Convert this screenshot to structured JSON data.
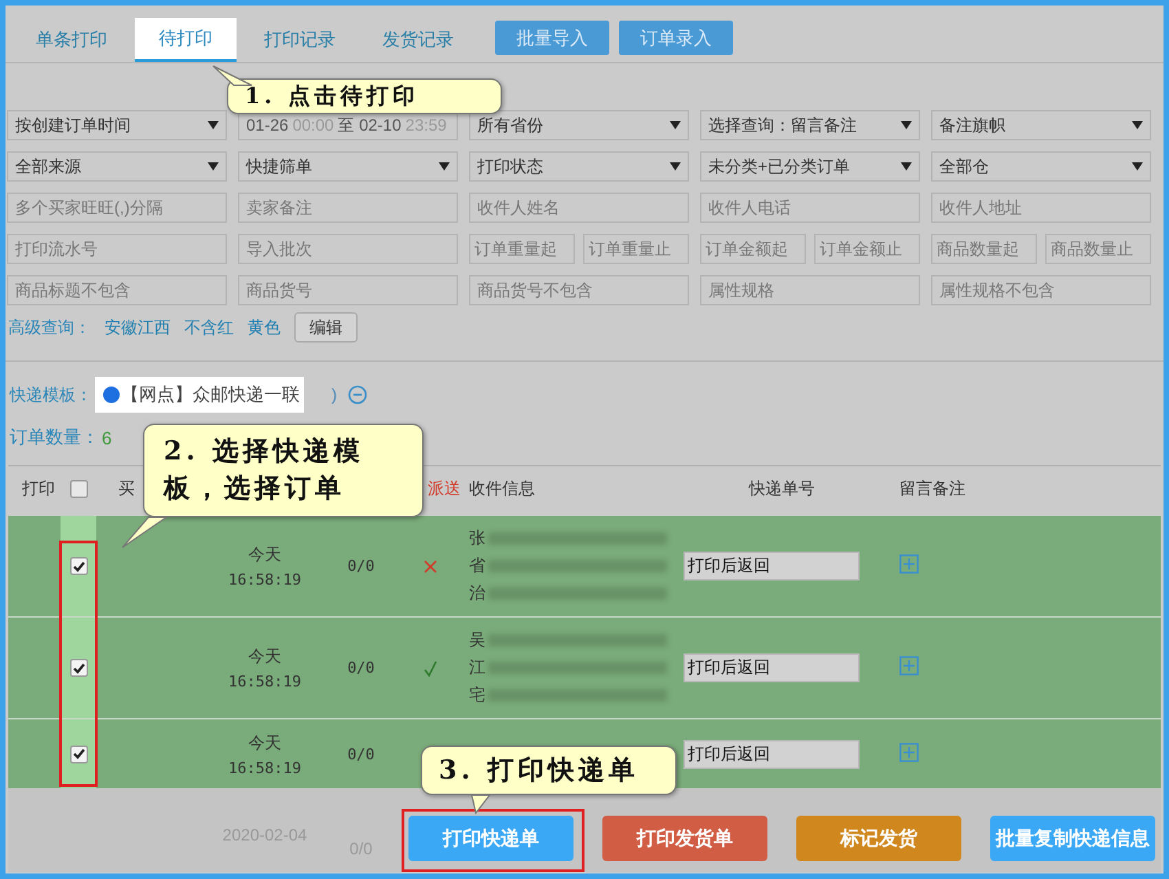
{
  "tabs": [
    {
      "label": "单条打印",
      "selected": false
    },
    {
      "label": "待打印",
      "selected": true
    },
    {
      "label": "打印记录",
      "selected": false
    },
    {
      "label": "发货记录",
      "selected": false
    }
  ],
  "top_buttons": [
    "批量导入",
    "订单录入"
  ],
  "filter_rows": [
    [
      {
        "kind": "select",
        "text": "按创建订单时间"
      },
      {
        "kind": "date",
        "start": "01-26",
        "start_time": "00:00",
        "sep": "至",
        "end": "02-10",
        "end_time": "23:59"
      },
      {
        "kind": "select",
        "text": "所有省份"
      },
      {
        "kind": "select",
        "text": "选择查询：留言备注"
      },
      {
        "kind": "select",
        "text": "备注旗帜"
      }
    ],
    [
      {
        "kind": "select",
        "text": "全部来源"
      },
      {
        "kind": "select",
        "text": "快捷筛单"
      },
      {
        "kind": "select",
        "text": "打印状态"
      },
      {
        "kind": "select",
        "text": "未分类+已分类订单"
      },
      {
        "kind": "select",
        "text": "全部仓"
      }
    ],
    [
      {
        "kind": "field",
        "placeholder": "多个买家旺旺(,)分隔"
      },
      {
        "kind": "field",
        "placeholder": "卖家备注"
      },
      {
        "kind": "field",
        "placeholder": "收件人姓名"
      },
      {
        "kind": "field",
        "placeholder": "收件人电话"
      },
      {
        "kind": "field",
        "placeholder": "收件人地址"
      }
    ],
    [
      {
        "kind": "field",
        "placeholder": "打印流水号"
      },
      {
        "kind": "field",
        "placeholder": "导入批次"
      },
      {
        "kind": "pair",
        "placeholders": [
          "订单重量起",
          "订单重量止"
        ]
      },
      {
        "kind": "pair",
        "placeholders": [
          "订单金额起",
          "订单金额止"
        ]
      },
      {
        "kind": "pair",
        "placeholders": [
          "商品数量起",
          "商品数量止"
        ]
      }
    ],
    [
      {
        "kind": "field",
        "placeholder": "商品标题不包含"
      },
      {
        "kind": "field",
        "placeholder": "商品货号"
      },
      {
        "kind": "field",
        "placeholder": "商品货号不包含"
      },
      {
        "kind": "field",
        "placeholder": "属性规格"
      },
      {
        "kind": "field",
        "placeholder": "属性规格不包含"
      }
    ]
  ],
  "advanced": {
    "label": "高级查询：",
    "tags": [
      "安徽江西",
      "不含红",
      "黄色"
    ],
    "edit_button": "编辑"
  },
  "template": {
    "label": "快递模板：",
    "option": "【网点】众邮快递一联",
    "selected": true,
    "fragment": ")"
  },
  "order_count": {
    "label": "订单数量：",
    "value": "6"
  },
  "table": {
    "header": {
      "print": "打印",
      "checked": false,
      "buyer": "买",
      "dispatch": "派送",
      "recipient": "收件信息",
      "tracking": "快递单号",
      "remark": "留言备注"
    },
    "rows": [
      {
        "checked": true,
        "day": "今天",
        "time": "16:58:19",
        "count": "0/0",
        "status": {
          "kind": "cross"
        },
        "recipient_lines": [
          "张",
          "省",
          "治"
        ],
        "tracking": "打印后返回"
      },
      {
        "checked": true,
        "day": "今天",
        "time": "16:58:19",
        "count": "0/0",
        "status": {
          "kind": "check"
        },
        "recipient_lines": [
          "吴",
          "江",
          "宅"
        ],
        "tracking": "打印后返回"
      },
      {
        "checked": true,
        "day": "今天",
        "time": "16:58:19",
        "count": "0/0",
        "recipient_lines": [],
        "tracking": "打印后返回"
      }
    ],
    "faded_row": {
      "date": "2020-02-04",
      "count": "0/0"
    }
  },
  "footer_buttons": [
    {
      "label": "打印快递单",
      "color": "#3aa8f5"
    },
    {
      "label": "打印发货单",
      "color": "#d25d45"
    },
    {
      "label": "标记发货",
      "color": "#d0871e"
    },
    {
      "label": "批量复制快递信息",
      "color": "#3aa8f5"
    }
  ],
  "callouts": [
    {
      "text": "1. 点击待打印"
    },
    {
      "text": "2. 选择快递模板，选择订单"
    },
    {
      "text": "3. 打印快递单"
    }
  ]
}
